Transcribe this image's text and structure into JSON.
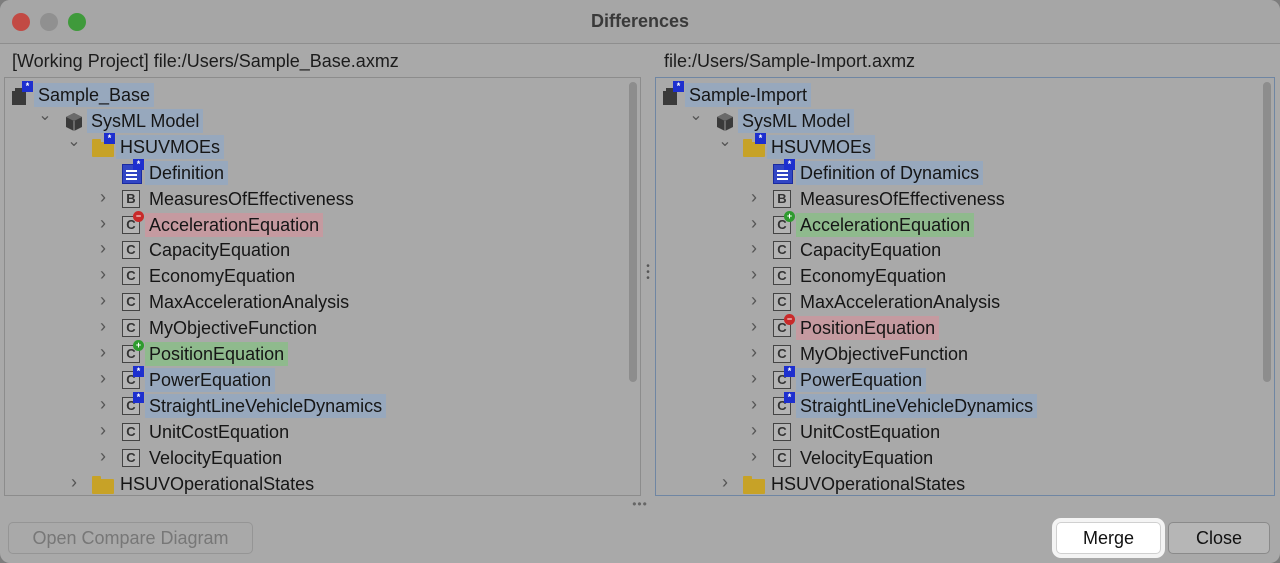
{
  "window": {
    "title": "Differences"
  },
  "left": {
    "header": "[Working Project] file:/Users/Sample_Base.axmz",
    "items": [
      {
        "label": "Sample_Base",
        "icon": "project-icon",
        "highlight": "blue",
        "badge": "blue"
      },
      {
        "label": "SysML Model",
        "icon": "model-icon",
        "highlight": "blue",
        "expanded": true
      },
      {
        "label": "HSUVMOEs",
        "icon": "folder-icon",
        "highlight": "blue",
        "expanded": true,
        "badge": "blue"
      },
      {
        "label": "Definition",
        "icon": "document-icon",
        "highlight": "blue",
        "badge": "blue"
      },
      {
        "label": "MeasuresOfEffectiveness",
        "icon": "block-icon",
        "letter": "B"
      },
      {
        "label": "AccelerationEquation",
        "icon": "constraint-icon",
        "letter": "C",
        "highlight": "red",
        "badge": "red"
      },
      {
        "label": "CapacityEquation",
        "icon": "constraint-icon",
        "letter": "C"
      },
      {
        "label": "EconomyEquation",
        "icon": "constraint-icon",
        "letter": "C"
      },
      {
        "label": "MaxAccelerationAnalysis",
        "icon": "constraint-icon",
        "letter": "C"
      },
      {
        "label": "MyObjectiveFunction",
        "icon": "constraint-icon",
        "letter": "C"
      },
      {
        "label": "PositionEquation",
        "icon": "constraint-icon",
        "letter": "C",
        "highlight": "green",
        "badge": "green"
      },
      {
        "label": "PowerEquation",
        "icon": "constraint-icon",
        "letter": "C",
        "highlight": "blue",
        "badge": "blue"
      },
      {
        "label": "StraightLineVehicleDynamics",
        "icon": "constraint-icon",
        "letter": "C",
        "highlight": "blue",
        "badge": "blue"
      },
      {
        "label": "UnitCostEquation",
        "icon": "constraint-icon",
        "letter": "C"
      },
      {
        "label": "VelocityEquation",
        "icon": "constraint-icon",
        "letter": "C"
      },
      {
        "label": "HSUVOperationalStates",
        "icon": "folder-icon"
      }
    ]
  },
  "right": {
    "header": "file:/Users/Sample-Import.axmz",
    "items": [
      {
        "label": "Sample-Import",
        "icon": "project-icon",
        "highlight": "blue",
        "badge": "blue"
      },
      {
        "label": "SysML Model",
        "icon": "model-icon",
        "highlight": "blue",
        "expanded": true
      },
      {
        "label": "HSUVMOEs",
        "icon": "folder-icon",
        "highlight": "blue",
        "expanded": true,
        "badge": "blue"
      },
      {
        "label": "Definition of Dynamics",
        "icon": "document-icon",
        "highlight": "blue",
        "badge": "blue"
      },
      {
        "label": "MeasuresOfEffectiveness",
        "icon": "block-icon",
        "letter": "B"
      },
      {
        "label": "AccelerationEquation",
        "icon": "constraint-icon",
        "letter": "C",
        "highlight": "green",
        "badge": "green"
      },
      {
        "label": "CapacityEquation",
        "icon": "constraint-icon",
        "letter": "C"
      },
      {
        "label": "EconomyEquation",
        "icon": "constraint-icon",
        "letter": "C"
      },
      {
        "label": "MaxAccelerationAnalysis",
        "icon": "constraint-icon",
        "letter": "C"
      },
      {
        "label": "PositionEquation",
        "icon": "constraint-icon",
        "letter": "C",
        "highlight": "red",
        "badge": "red"
      },
      {
        "label": "MyObjectiveFunction",
        "icon": "constraint-icon",
        "letter": "C"
      },
      {
        "label": "PowerEquation",
        "icon": "constraint-icon",
        "letter": "C",
        "highlight": "blue",
        "badge": "blue"
      },
      {
        "label": "StraightLineVehicleDynamics",
        "icon": "constraint-icon",
        "letter": "C",
        "highlight": "blue",
        "badge": "blue"
      },
      {
        "label": "UnitCostEquation",
        "icon": "constraint-icon",
        "letter": "C"
      },
      {
        "label": "VelocityEquation",
        "icon": "constraint-icon",
        "letter": "C"
      },
      {
        "label": "HSUVOperationalStates",
        "icon": "folder-icon"
      }
    ]
  },
  "buttons": {
    "compare": "Open Compare Diagram",
    "merge": "Merge",
    "close": "Close"
  },
  "colors": {
    "changed": "#97a8bd",
    "removed": "#c59aa0",
    "added": "#8fba8d"
  }
}
